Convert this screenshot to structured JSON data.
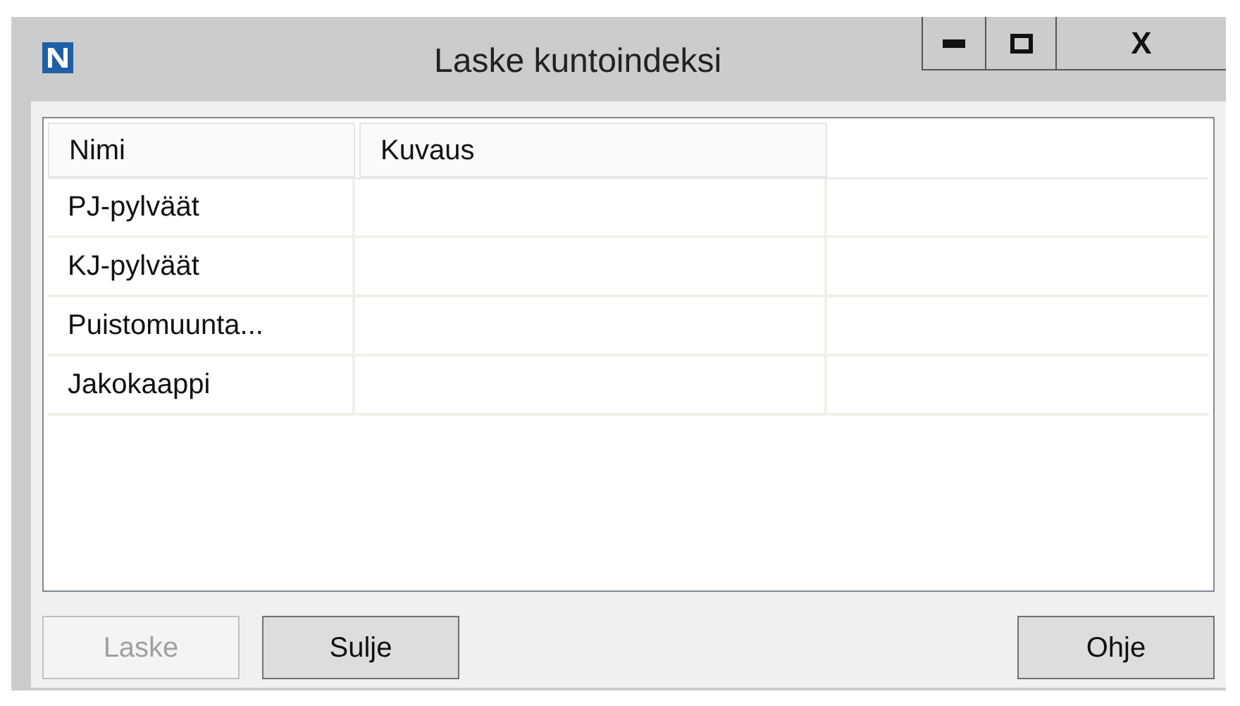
{
  "window": {
    "title": "Laske kuntoindeksi",
    "controls": [
      {
        "kind": "minimize"
      },
      {
        "kind": "maximize"
      },
      {
        "kind": "close",
        "label": "X"
      }
    ]
  },
  "table": {
    "columns": [
      "Nimi",
      "Kuvaus"
    ],
    "rows": [
      {
        "name": "PJ-pylväät"
      },
      {
        "name": "KJ-pylväät"
      },
      {
        "name": "Puistomuunta..."
      },
      {
        "name": "Jakokaappi"
      }
    ]
  },
  "buttons": [
    {
      "label": "Laske",
      "disabled": true
    },
    {
      "label": "Sulje",
      "disabled": false
    },
    {
      "label": "Ohje",
      "disabled": false
    }
  ]
}
